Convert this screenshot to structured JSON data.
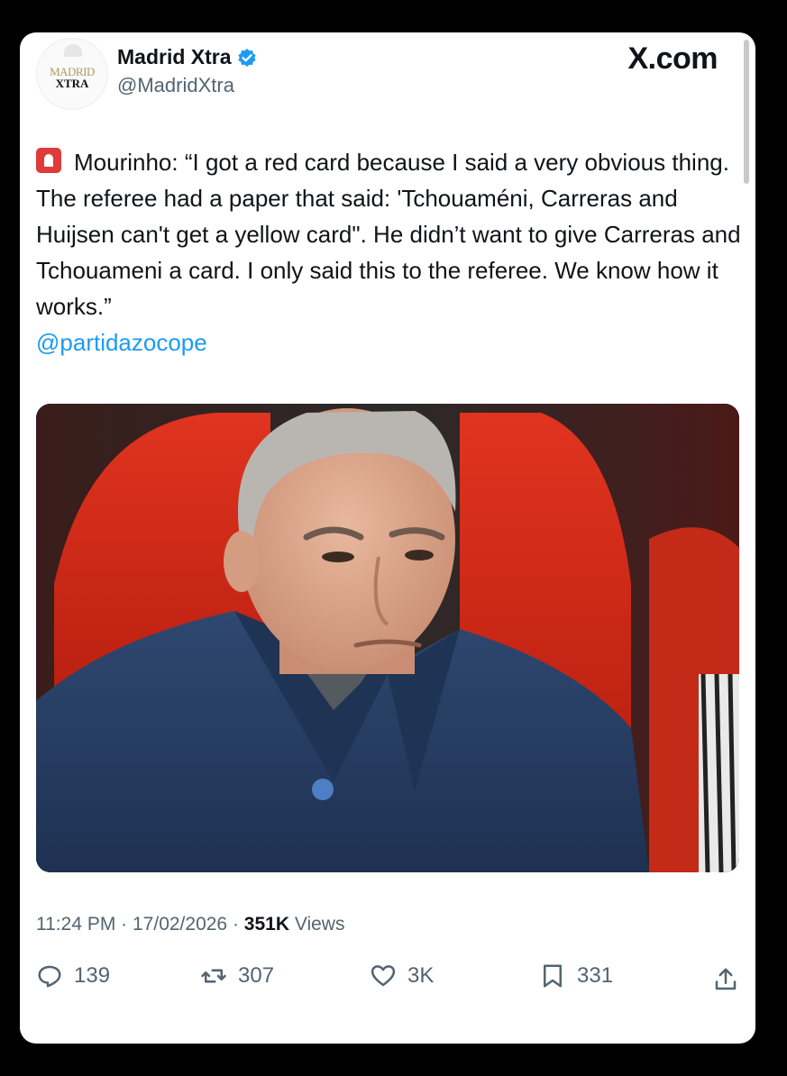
{
  "author": {
    "display_name": "Madrid Xtra",
    "handle": "@MadridXtra",
    "avatar_text_top": "MADRID",
    "avatar_text_bottom": "XTRA"
  },
  "site_label": "X.com",
  "tweet": {
    "text": "Mourinho: “I got a red card because I said a very obvious thing. The referee had a paper that said: 'Tchouaméni, Carreras and Huijsen can't get a yellow card\". He didn’t want to give Carreras and Tchouameni a card. I only said this to the referee. We know how it works.”",
    "mention": "@partidazocope"
  },
  "meta": {
    "time": "11:24 PM",
    "date": "17/02/2026",
    "views_count": "351K",
    "views_label": "Views"
  },
  "actions": {
    "replies": "139",
    "reposts": "307",
    "likes": "3K",
    "bookmarks": "331"
  },
  "icons": {
    "verified": "verified-badge-icon",
    "siren": "siren-emoji-icon",
    "reply": "reply-icon",
    "repost": "repost-icon",
    "like": "heart-icon",
    "bookmark": "bookmark-icon",
    "share": "share-icon"
  },
  "colors": {
    "accent": "#1d9bf0",
    "text": "#0f1419",
    "muted": "#536471"
  }
}
